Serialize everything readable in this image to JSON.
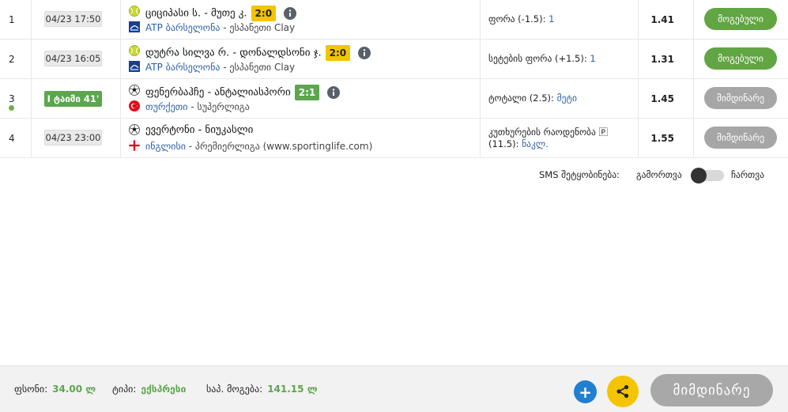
{
  "rows": [
    {
      "num": "1",
      "time": "04/23 17:50",
      "live": false,
      "sport_icon": "tennis-ball-icon",
      "flag_icon": "atp-logo-icon",
      "teams": "ციციპასი ს. - მუთე კ.",
      "score": "2:0",
      "score_style": "yellow",
      "has_info": true,
      "league_country": "ATP ბარსელონა",
      "league_rest": " - ესპანეთი Clay",
      "bet_market": "ფორა (-1.5): ",
      "bet_pick": "1",
      "odds": "1.41",
      "status": "მოგებული",
      "status_style": "won"
    },
    {
      "num": "2",
      "time": "04/23 16:05",
      "live": false,
      "sport_icon": "tennis-ball-icon",
      "flag_icon": "atp-logo-icon",
      "teams": "დუტრა სილვა რ. - დონალდსონი ჯ.",
      "score": "2:0",
      "score_style": "yellow",
      "has_info": true,
      "league_country": "ATP ბარსელონა",
      "league_rest": " - ესპანეთი Clay",
      "bet_market": "სეტების ფორა (+1.5): ",
      "bet_pick": "1",
      "odds": "1.31",
      "status": "მოგებული",
      "status_style": "won"
    },
    {
      "num": "3",
      "time": "I ტაიმი 41'",
      "live": true,
      "sport_icon": "soccer-ball-icon",
      "flag_icon": "turkey-flag-icon",
      "teams": "ფენერბაჰჩე - ანტალიასპორი",
      "score": "2:1",
      "score_style": "green",
      "has_info": true,
      "league_country": "თურქეთი",
      "league_rest": " - სუპერლიგა",
      "bet_market": "ტოტალი (2.5): ",
      "bet_pick": "მეტი",
      "odds": "1.45",
      "status": "მიმდინარე",
      "status_style": "pending"
    },
    {
      "num": "4",
      "time": "04/23 23:00",
      "live": false,
      "sport_icon": "soccer-ball-icon",
      "flag_icon": "england-flag-icon",
      "teams": "ევერტონი - ნიუკასლი",
      "score": "",
      "score_style": "",
      "has_info": false,
      "league_country": "ინგლისი",
      "league_rest": " - პრემიერლიგა (www.sportinglife.com)",
      "bet_market": "კუთხურების რაოდენობა 🄿 (11.5): ",
      "bet_pick": "ნაკლ.",
      "odds": "1.55",
      "status": "მიმდინარე",
      "status_style": "pending"
    }
  ],
  "sms": {
    "label": "SMS შეტყობინება:",
    "off_label": "გამორთვა",
    "on_label": "ჩართვა"
  },
  "footer": {
    "stake_label": "ფსონი:",
    "stake_value": "34.00 ლ",
    "type_label": "ტიპი:",
    "type_value": "ექსპრესი",
    "win_label": "საპ. მოგება:",
    "win_value": "141.15 ლ",
    "plus_label": "+",
    "big_button": "მიმდინარე"
  },
  "colors": {
    "won": "#62a543",
    "pending": "#a6a6a6",
    "link": "#2b5fa8",
    "score_yellow": "#f4c400",
    "live_green": "#5ca64d",
    "plus_blue": "#1f7fd1"
  }
}
